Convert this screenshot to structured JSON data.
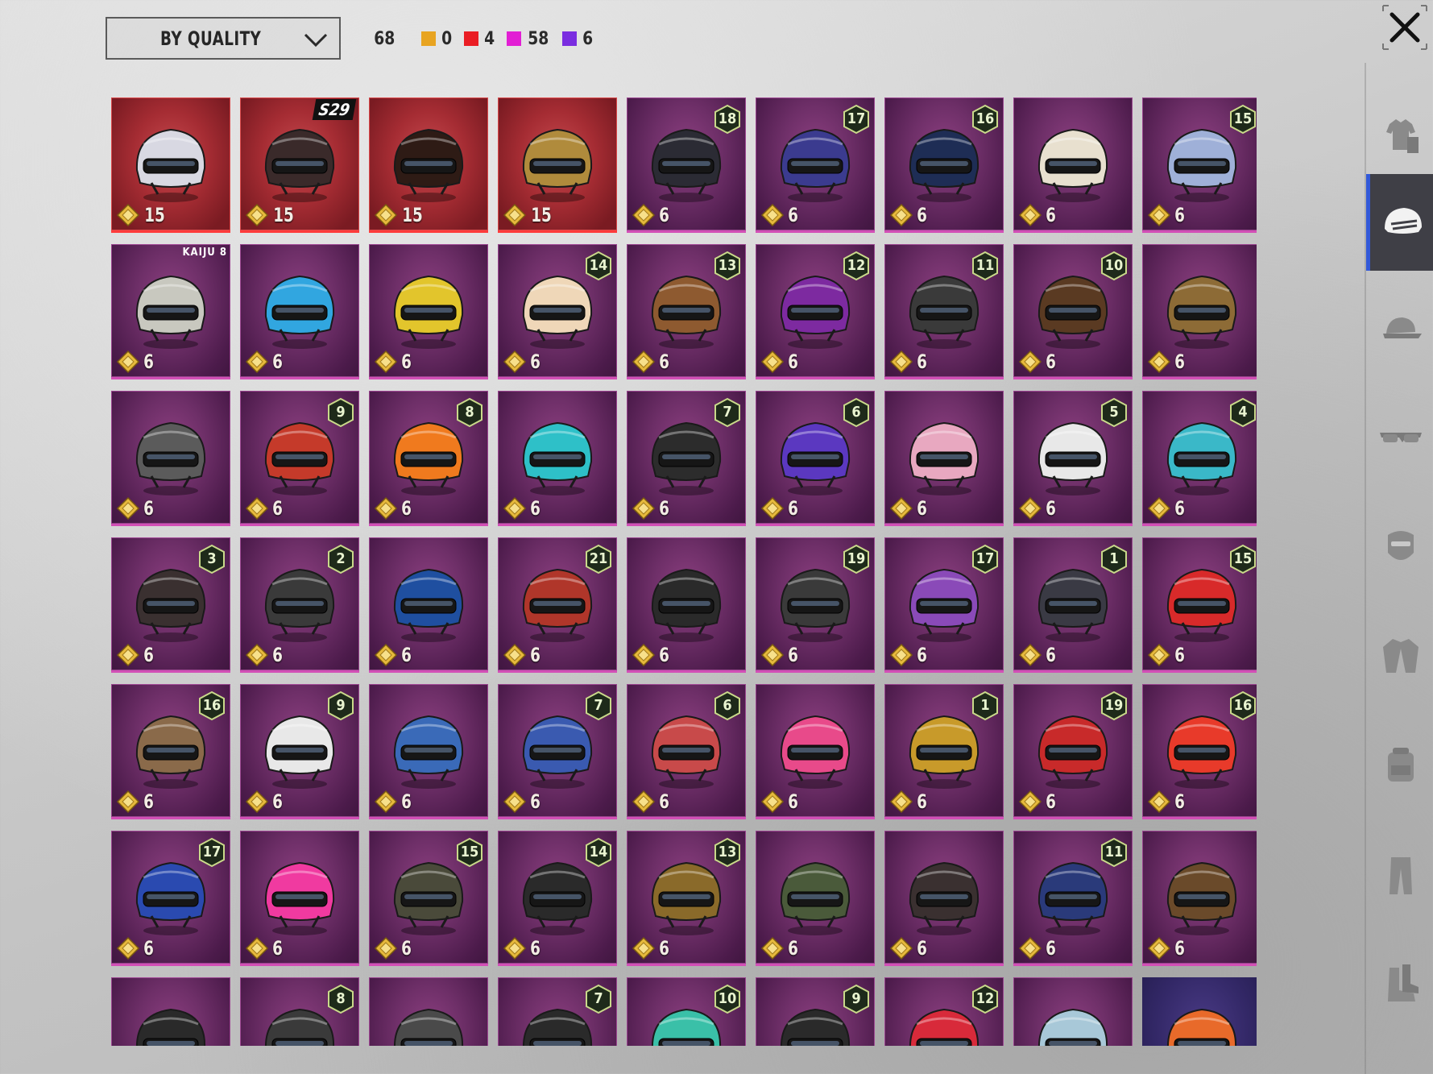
{
  "filter": {
    "sort_label": "BY QUALITY"
  },
  "counts": {
    "total": "68",
    "legend": [
      {
        "color": "#e8a421",
        "value": "0"
      },
      {
        "color": "#ea1d24",
        "value": "4"
      },
      {
        "color": "#e21fd4",
        "value": "58"
      },
      {
        "color": "#7a2de0",
        "value": "6"
      }
    ]
  },
  "sidebar": {
    "categories": [
      {
        "icon": "outfit-icon",
        "active": false
      },
      {
        "icon": "helmet-icon",
        "active": true
      },
      {
        "icon": "hat-icon",
        "active": false
      },
      {
        "icon": "glasses-icon",
        "active": false
      },
      {
        "icon": "mask-icon",
        "active": false
      },
      {
        "icon": "jacket-icon",
        "active": false
      },
      {
        "icon": "backpack-icon",
        "active": false
      },
      {
        "icon": "pants-icon",
        "active": false
      },
      {
        "icon": "shoes-icon",
        "active": false
      }
    ]
  },
  "items": [
    {
      "quality": "red",
      "price": "15",
      "level": "",
      "tag": "",
      "hue": "#d8d8e2"
    },
    {
      "quality": "red",
      "price": "15",
      "level": "",
      "tag": "S29",
      "hue": "#3a2a2a"
    },
    {
      "quality": "red",
      "price": "15",
      "level": "",
      "tag": "",
      "hue": "#2e1b15"
    },
    {
      "quality": "red",
      "price": "15",
      "level": "",
      "tag": "",
      "hue": "#b08b3c"
    },
    {
      "quality": "purple",
      "price": "6",
      "level": "18",
      "tag": "",
      "hue": "#2b2b34"
    },
    {
      "quality": "purple",
      "price": "6",
      "level": "17",
      "tag": "",
      "hue": "#3b3b8f"
    },
    {
      "quality": "purple",
      "price": "6",
      "level": "16",
      "tag": "",
      "hue": "#1e2d55"
    },
    {
      "quality": "purple",
      "price": "6",
      "level": "",
      "tag": "",
      "hue": "#e8e0cf"
    },
    {
      "quality": "purple",
      "price": "6",
      "level": "15",
      "tag": "",
      "hue": "#9fb0d8"
    },
    {
      "quality": "purple",
      "price": "6",
      "level": "",
      "tag": "KAIJU 8",
      "hue": "#c8c8bf"
    },
    {
      "quality": "purple",
      "price": "6",
      "level": "",
      "tag": "",
      "hue": "#31a6e0"
    },
    {
      "quality": "purple",
      "price": "6",
      "level": "",
      "tag": "",
      "hue": "#e2c52c"
    },
    {
      "quality": "purple",
      "price": "6",
      "level": "14",
      "tag": "",
      "hue": "#efd7b8"
    },
    {
      "quality": "purple",
      "price": "6",
      "level": "13",
      "tag": "",
      "hue": "#8e5a30"
    },
    {
      "quality": "purple",
      "price": "6",
      "level": "12",
      "tag": "",
      "hue": "#7d2aa0"
    },
    {
      "quality": "purple",
      "price": "6",
      "level": "11",
      "tag": "",
      "hue": "#3a3a3a"
    },
    {
      "quality": "purple",
      "price": "6",
      "level": "10",
      "tag": "",
      "hue": "#5a3a22"
    },
    {
      "quality": "purple",
      "price": "6",
      "level": "",
      "tag": "",
      "hue": "#8d6b36"
    },
    {
      "quality": "purple",
      "price": "6",
      "level": "",
      "tag": "",
      "hue": "#5b5b5b"
    },
    {
      "quality": "purple",
      "price": "6",
      "level": "9",
      "tag": "",
      "hue": "#c53a2a"
    },
    {
      "quality": "purple",
      "price": "6",
      "level": "8",
      "tag": "",
      "hue": "#f07a1e"
    },
    {
      "quality": "purple",
      "price": "6",
      "level": "",
      "tag": "",
      "hue": "#2ec0c8"
    },
    {
      "quality": "purple",
      "price": "6",
      "level": "7",
      "tag": "",
      "hue": "#2c2c2c"
    },
    {
      "quality": "purple",
      "price": "6",
      "level": "6",
      "tag": "",
      "hue": "#5b38c0"
    },
    {
      "quality": "purple",
      "price": "6",
      "level": "",
      "tag": "",
      "hue": "#e8a8c0"
    },
    {
      "quality": "purple",
      "price": "6",
      "level": "5",
      "tag": "",
      "hue": "#e8e8e8"
    },
    {
      "quality": "purple",
      "price": "6",
      "level": "4",
      "tag": "",
      "hue": "#3ab8c8"
    },
    {
      "quality": "purple",
      "price": "6",
      "level": "3",
      "tag": "",
      "hue": "#3a3030"
    },
    {
      "quality": "purple",
      "price": "6",
      "level": "2",
      "tag": "",
      "hue": "#3a3a3a"
    },
    {
      "quality": "purple",
      "price": "6",
      "level": "",
      "tag": "",
      "hue": "#1f4fa0"
    },
    {
      "quality": "purple",
      "price": "6",
      "level": "21",
      "tag": "",
      "hue": "#b0362a"
    },
    {
      "quality": "purple",
      "price": "6",
      "level": "",
      "tag": "",
      "hue": "#2a2a2a"
    },
    {
      "quality": "purple",
      "price": "6",
      "level": "19",
      "tag": "",
      "hue": "#3a3a3a"
    },
    {
      "quality": "purple",
      "price": "6",
      "level": "17",
      "tag": "",
      "hue": "#8a4ab8"
    },
    {
      "quality": "purple",
      "price": "6",
      "level": "1",
      "tag": "",
      "hue": "#3a3a44"
    },
    {
      "quality": "purple",
      "price": "6",
      "level": "15",
      "tag": "",
      "hue": "#d82a2a"
    },
    {
      "quality": "purple",
      "price": "6",
      "level": "16",
      "tag": "",
      "hue": "#8a6a4a"
    },
    {
      "quality": "purple",
      "price": "6",
      "level": "9",
      "tag": "",
      "hue": "#e8e8e8"
    },
    {
      "quality": "purple",
      "price": "6",
      "level": "",
      "tag": "",
      "hue": "#3a6ab8"
    },
    {
      "quality": "purple",
      "price": "6",
      "level": "7",
      "tag": "",
      "hue": "#3a5ab0"
    },
    {
      "quality": "purple",
      "price": "6",
      "level": "6",
      "tag": "",
      "hue": "#c84a4a"
    },
    {
      "quality": "purple",
      "price": "6",
      "level": "",
      "tag": "",
      "hue": "#e84a8a"
    },
    {
      "quality": "purple",
      "price": "6",
      "level": "1",
      "tag": "",
      "hue": "#c89a2a"
    },
    {
      "quality": "purple",
      "price": "6",
      "level": "19",
      "tag": "",
      "hue": "#c82a2a"
    },
    {
      "quality": "purple",
      "price": "6",
      "level": "16",
      "tag": "",
      "hue": "#e83a2a"
    },
    {
      "quality": "purple",
      "price": "6",
      "level": "17",
      "tag": "",
      "hue": "#2a4ab0"
    },
    {
      "quality": "purple",
      "price": "6",
      "level": "",
      "tag": "",
      "hue": "#f03aa0"
    },
    {
      "quality": "purple",
      "price": "6",
      "level": "15",
      "tag": "",
      "hue": "#4a4a3a"
    },
    {
      "quality": "purple",
      "price": "6",
      "level": "14",
      "tag": "",
      "hue": "#2a2a2a"
    },
    {
      "quality": "purple",
      "price": "6",
      "level": "13",
      "tag": "",
      "hue": "#8a6a2a"
    },
    {
      "quality": "purple",
      "price": "6",
      "level": "",
      "tag": "",
      "hue": "#4a5a3a"
    },
    {
      "quality": "purple",
      "price": "6",
      "level": "",
      "tag": "",
      "hue": "#3a3030"
    },
    {
      "quality": "purple",
      "price": "6",
      "level": "11",
      "tag": "",
      "hue": "#2a3a7a"
    },
    {
      "quality": "purple",
      "price": "6",
      "level": "",
      "tag": "",
      "hue": "#6a4a2a"
    },
    {
      "quality": "purple",
      "price": "",
      "level": "",
      "tag": "",
      "hue": "#2a2a2a"
    },
    {
      "quality": "purple",
      "price": "",
      "level": "8",
      "tag": "",
      "hue": "#3a3a3a"
    },
    {
      "quality": "purple",
      "price": "",
      "level": "",
      "tag": "",
      "hue": "#4a4a4a"
    },
    {
      "quality": "purple",
      "price": "",
      "level": "7",
      "tag": "",
      "hue": "#2a2a2a"
    },
    {
      "quality": "purple",
      "price": "",
      "level": "10",
      "tag": "",
      "hue": "#3ac0a8"
    },
    {
      "quality": "purple",
      "price": "",
      "level": "9",
      "tag": "",
      "hue": "#2a2a2a"
    },
    {
      "quality": "purple",
      "price": "",
      "level": "12",
      "tag": "",
      "hue": "#d82a3a"
    },
    {
      "quality": "purple",
      "price": "",
      "level": "",
      "tag": "",
      "hue": "#a8c8d8"
    },
    {
      "quality": "blue",
      "price": "",
      "level": "",
      "tag": "",
      "hue": "#e86a2a"
    }
  ]
}
